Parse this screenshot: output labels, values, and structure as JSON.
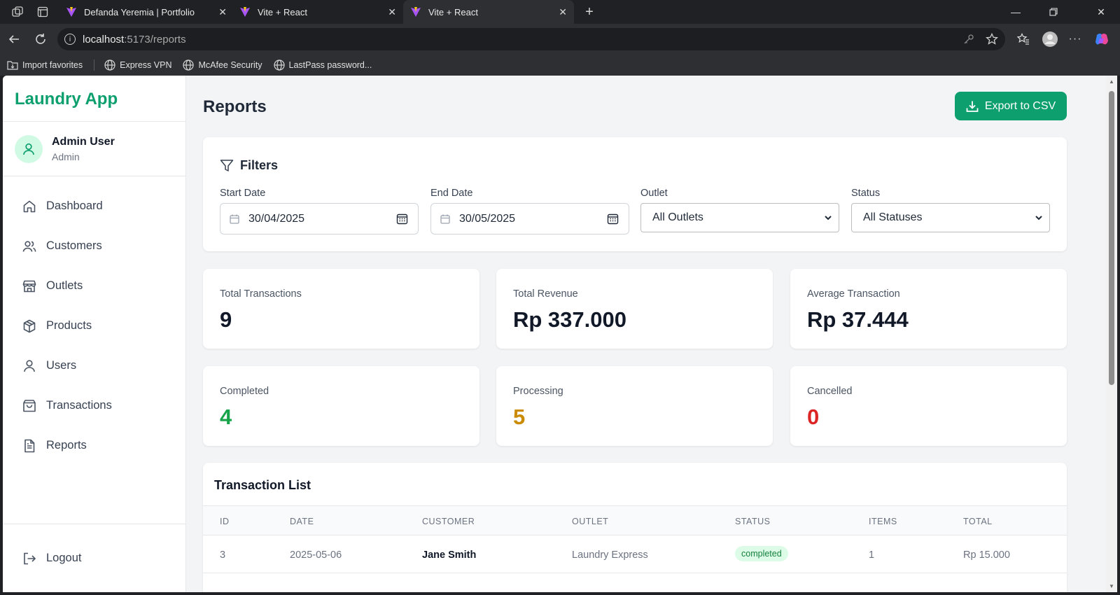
{
  "browser": {
    "tabs": [
      {
        "title": "Defanda Yeremia | Portfolio"
      },
      {
        "title": "Vite + React"
      },
      {
        "title": "Vite + React"
      }
    ],
    "url_host": "localhost",
    "url_path": ":5173/reports",
    "bookmarks": [
      {
        "label": "Import favorites"
      },
      {
        "label": "Express VPN"
      },
      {
        "label": "McAfee Security"
      },
      {
        "label": "LastPass password..."
      }
    ]
  },
  "sidebar": {
    "brand": "Laundry App",
    "user": {
      "name": "Admin User",
      "role": "Admin"
    },
    "items": [
      {
        "label": "Dashboard",
        "icon": "home-icon"
      },
      {
        "label": "Customers",
        "icon": "users-icon"
      },
      {
        "label": "Outlets",
        "icon": "store-icon"
      },
      {
        "label": "Products",
        "icon": "package-icon"
      },
      {
        "label": "Users",
        "icon": "user-icon"
      },
      {
        "label": "Transactions",
        "icon": "shopping-bag-icon"
      },
      {
        "label": "Reports",
        "icon": "file-text-icon"
      }
    ],
    "logout": "Logout"
  },
  "page": {
    "title": "Reports",
    "export_label": "Export to CSV"
  },
  "filters": {
    "title": "Filters",
    "start_date": {
      "label": "Start Date",
      "value": "30/04/2025"
    },
    "end_date": {
      "label": "End Date",
      "value": "30/05/2025"
    },
    "outlet": {
      "label": "Outlet",
      "value": "All Outlets"
    },
    "status": {
      "label": "Status",
      "value": "All Statuses"
    }
  },
  "stats": {
    "total_transactions": {
      "label": "Total Transactions",
      "value": "9"
    },
    "total_revenue": {
      "label": "Total Revenue",
      "value": "Rp 337.000"
    },
    "average_transaction": {
      "label": "Average Transaction",
      "value": "Rp 37.444"
    },
    "completed": {
      "label": "Completed",
      "value": "4",
      "color": "#16a34a"
    },
    "processing": {
      "label": "Processing",
      "value": "5",
      "color": "#ca8a04"
    },
    "cancelled": {
      "label": "Cancelled",
      "value": "0",
      "color": "#dc2626"
    }
  },
  "transactions": {
    "title": "Transaction List",
    "columns": [
      "ID",
      "DATE",
      "CUSTOMER",
      "OUTLET",
      "STATUS",
      "ITEMS",
      "TOTAL"
    ],
    "rows": [
      {
        "id": "3",
        "date": "2025-05-06",
        "customer": "Jane Smith",
        "outlet": "Laundry Express",
        "status": "completed",
        "items": "1",
        "total": "Rp 15.000"
      }
    ]
  },
  "colors": {
    "accent": "#0e9f6e"
  }
}
